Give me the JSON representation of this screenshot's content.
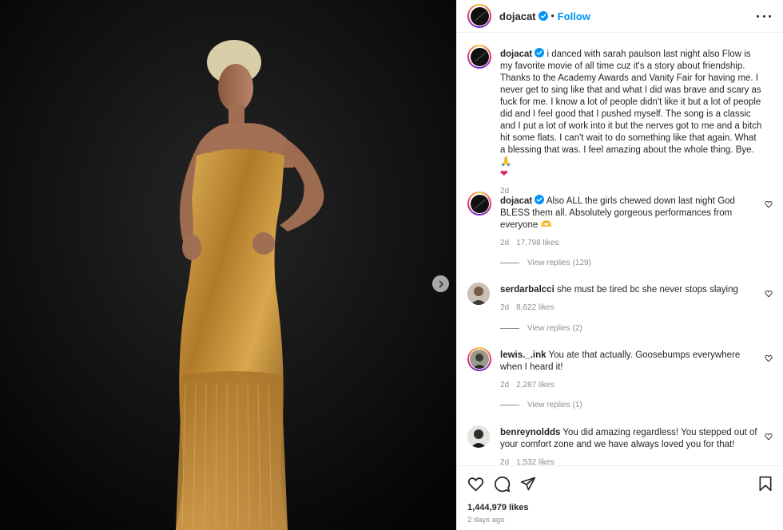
{
  "post": {
    "username": "dojacat",
    "follow_label": "Follow",
    "separator": "•",
    "caption_text": "i danced with sarah paulson last night also Flow is my favorite movie of all time cuz it's a story about friendship. Thanks to the Academy Awards and Vanity Fair for having me. I never get to sing like that and what I did was brave and scary as fuck for me. I know a lot of people didn't like it but a lot of people did and I feel good that I pushed myself. The song is a classic and I put a lot of work into it but the nerves got to me and a bitch hit some flats. I can't wait to do something like that again. What a blessing that was. I feel amazing about the whole thing. Bye. 🙏",
    "caption_heart": "❤",
    "caption_age": "2d",
    "likes": "1,444,979 likes",
    "posted": "2 days ago",
    "accent_color": "#0095f6",
    "verified_color": "#0095f6"
  },
  "comments": [
    {
      "username": "dojacat",
      "text": "Also ALL the girls chewed down last night God BLESS them all. Absolutely gorgeous performances from everyone 🫶",
      "age": "2d",
      "likes": "17,798 likes",
      "replies": "View replies (129)"
    },
    {
      "username": "serdarbalcci",
      "text": "she must be tired bc she never stops slaying",
      "age": "2d",
      "likes": "8,622 likes",
      "replies": "View replies (2)"
    },
    {
      "username": "lewis._.ink",
      "text": "You ate that actually. Goosebumps everywhere when I heard it!",
      "age": "2d",
      "likes": "2,287 likes",
      "replies": "View replies (1)"
    },
    {
      "username": "benreynoldds",
      "text": "You did amazing regardless! You stepped out of your comfort zone and we have always loved you for that!",
      "age": "2d",
      "likes": "1,532 likes"
    }
  ],
  "icons": {
    "more": "more-options-icon",
    "next": "chevron-right-icon",
    "like": "heart-icon",
    "comment": "comment-icon",
    "share": "share-icon",
    "save": "bookmark-icon"
  }
}
